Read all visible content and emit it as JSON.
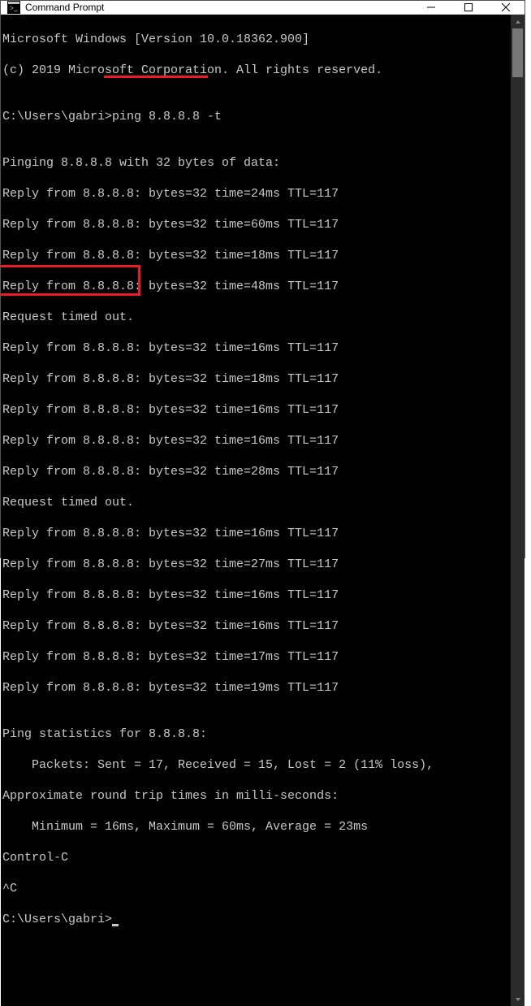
{
  "titlebar": {
    "title": "Command Prompt"
  },
  "terminal": {
    "header1": "Microsoft Windows [Version 10.0.18362.900]",
    "header2": "(c) 2019 Microsoft Corporation. All rights reserved.",
    "blank": "",
    "prompt1": "C:\\Users\\gabri>ping 8.8.8.8 -t",
    "pingHeader": "Pinging 8.8.8.8 with 32 bytes of data:",
    "r01": "Reply from 8.8.8.8: bytes=32 time=24ms TTL=117",
    "r02": "Reply from 8.8.8.8: bytes=32 time=60ms TTL=117",
    "r03": "Reply from 8.8.8.8: bytes=32 time=18ms TTL=117",
    "r04": "Reply from 8.8.8.8: bytes=32 time=48ms TTL=117",
    "r05": "Request timed out.",
    "r06": "Reply from 8.8.8.8: bytes=32 time=16ms TTL=117",
    "r07": "Reply from 8.8.8.8: bytes=32 time=18ms TTL=117",
    "r08": "Reply from 8.8.8.8: bytes=32 time=16ms TTL=117",
    "r09": "Reply from 8.8.8.8: bytes=32 time=16ms TTL=117",
    "r10": "Reply from 8.8.8.8: bytes=32 time=28ms TTL=117",
    "r11": "Request timed out.",
    "r12": "Reply from 8.8.8.8: bytes=32 time=16ms TTL=117",
    "r13": "Reply from 8.8.8.8: bytes=32 time=27ms TTL=117",
    "r14": "Reply from 8.8.8.8: bytes=32 time=16ms TTL=117",
    "r15": "Reply from 8.8.8.8: bytes=32 time=16ms TTL=117",
    "r16": "Reply from 8.8.8.8: bytes=32 time=17ms TTL=117",
    "r17": "Reply from 8.8.8.8: bytes=32 time=19ms TTL=117",
    "statsHeader": "Ping statistics for 8.8.8.8:",
    "statsPackets": "    Packets: Sent = 17, Received = 15, Lost = 2 (11% loss),",
    "statsRound": "Approximate round trip times in milli-seconds:",
    "statsMinMax": "    Minimum = 16ms, Maximum = 60ms, Average = 23ms",
    "ctrlC": "Control-C",
    "caret": "^C",
    "prompt2": "C:\\Users\\gabri>"
  }
}
